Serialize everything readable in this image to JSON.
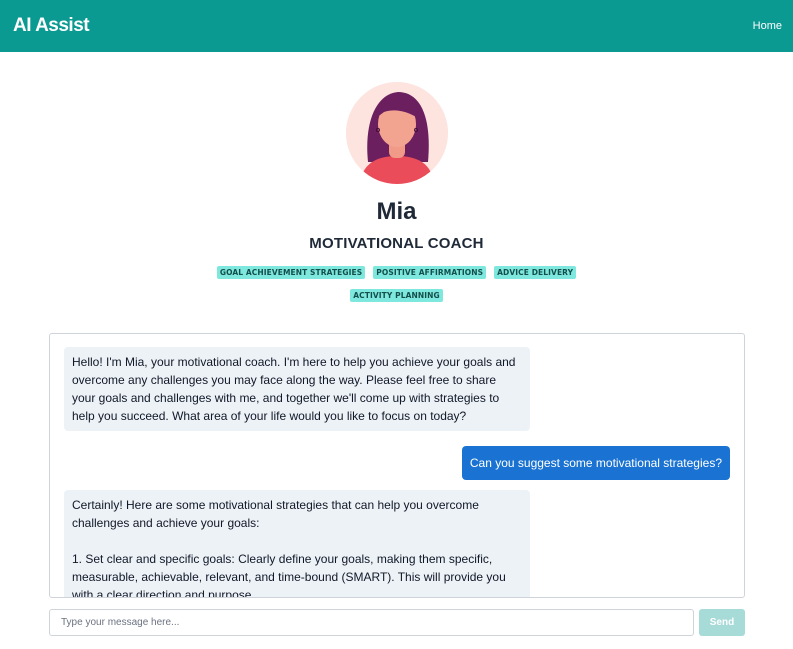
{
  "navbar": {
    "brand": "AI Assist",
    "home_link": "Home"
  },
  "profile": {
    "name": "Mia",
    "role": "MOTIVATIONAL COACH",
    "tags_row1": [
      "GOAL ACHIEVEMENT STRATEGIES",
      "POSITIVE AFFIRMATIONS",
      "ADVICE DELIVERY"
    ],
    "tags_row2": [
      "ACTIVITY PLANNING"
    ]
  },
  "chat": {
    "messages": [
      {
        "sender": "bot",
        "text": "Hello! I'm Mia, your motivational coach. I'm here to help you achieve your goals and overcome any challenges you may face along the way. Please feel free to share your goals and challenges with me, and together we'll come up with strategies to help you succeed. What area of your life would you like to focus on today?"
      },
      {
        "sender": "user",
        "text": "Can you suggest some motivational strategies?"
      },
      {
        "sender": "bot",
        "text": "Certainly! Here are some motivational strategies that can help you overcome challenges and achieve your goals:\n\n1. Set clear and specific goals: Clearly define your goals, making them specific, measurable, achievable, relevant, and time-bound (SMART). This will provide you with a clear direction and purpose."
      }
    ]
  },
  "input": {
    "placeholder": "Type your message here...",
    "value": ""
  },
  "send_button": {
    "label": "Send"
  },
  "colors": {
    "navbar": "#0b9a92",
    "tag_bg": "#7ee8df",
    "user_bubble": "#1a73d2",
    "bot_bubble": "#edf2f7",
    "send_disabled": "#a7dbd8"
  }
}
